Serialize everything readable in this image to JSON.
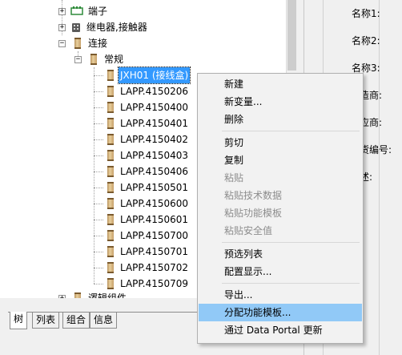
{
  "tree": {
    "nodes": [
      {
        "label": "端子",
        "icon": "terminal-icon",
        "expander": "+"
      },
      {
        "label": "继电器,接触器",
        "icon": "relay-icon",
        "expander": "+"
      },
      {
        "label": "连接",
        "icon": "connector-icon",
        "expander": "−"
      },
      {
        "label": "常规",
        "icon": "connector-icon",
        "expander": "−"
      },
      {
        "label": "JXH01 (接线盒)",
        "icon": "connector-icon",
        "selected": true
      },
      {
        "label": "LAPP.4150206",
        "icon": "connector-icon"
      },
      {
        "label": "LAPP.4150400",
        "icon": "connector-icon"
      },
      {
        "label": "LAPP.4150401",
        "icon": "connector-icon"
      },
      {
        "label": "LAPP.4150402",
        "icon": "connector-icon"
      },
      {
        "label": "LAPP.4150403",
        "icon": "connector-icon"
      },
      {
        "label": "LAPP.4150406",
        "icon": "connector-icon"
      },
      {
        "label": "LAPP.4150501",
        "icon": "connector-icon"
      },
      {
        "label": "LAPP.4150600",
        "icon": "connector-icon"
      },
      {
        "label": "LAPP.4150601",
        "icon": "connector-icon"
      },
      {
        "label": "LAPP.4150700",
        "icon": "connector-icon"
      },
      {
        "label": "LAPP.4150701",
        "icon": "connector-icon"
      },
      {
        "label": "LAPP.4150702",
        "icon": "connector-icon"
      },
      {
        "label": "LAPP.4150709",
        "icon": "connector-icon"
      },
      {
        "label": "逻辑组件",
        "icon": "connector-icon",
        "expander": "+"
      }
    ]
  },
  "tabs": [
    "树",
    "列表",
    "组合",
    "信息"
  ],
  "properties": {
    "name1": "名称1:",
    "name2": "名称2:",
    "name3": "名称3:",
    "manufacturer": "造商:",
    "supplier": "应商:",
    "order_no": "货编号:",
    "description": "述:"
  },
  "context_menu": {
    "items": [
      {
        "label": "新建"
      },
      {
        "label": "新变量..."
      },
      {
        "label": "删除"
      },
      {
        "separator": true
      },
      {
        "label": "剪切"
      },
      {
        "label": "复制"
      },
      {
        "label": "粘贴",
        "disabled": true
      },
      {
        "label": "粘贴技术数据",
        "disabled": true
      },
      {
        "label": "粘贴功能模板",
        "disabled": true
      },
      {
        "label": "粘贴安全值",
        "disabled": true
      },
      {
        "separator": true
      },
      {
        "label": "预选列表"
      },
      {
        "label": "配置显示..."
      },
      {
        "separator": true
      },
      {
        "label": "导出..."
      },
      {
        "label": "分配功能模板...",
        "hover": true
      },
      {
        "label": "通过 Data Portal 更新"
      }
    ]
  },
  "colors": {
    "selection": "#3399ff",
    "menu_hover": "#91c9f7",
    "terminal_icon": "#2e8b3a"
  }
}
